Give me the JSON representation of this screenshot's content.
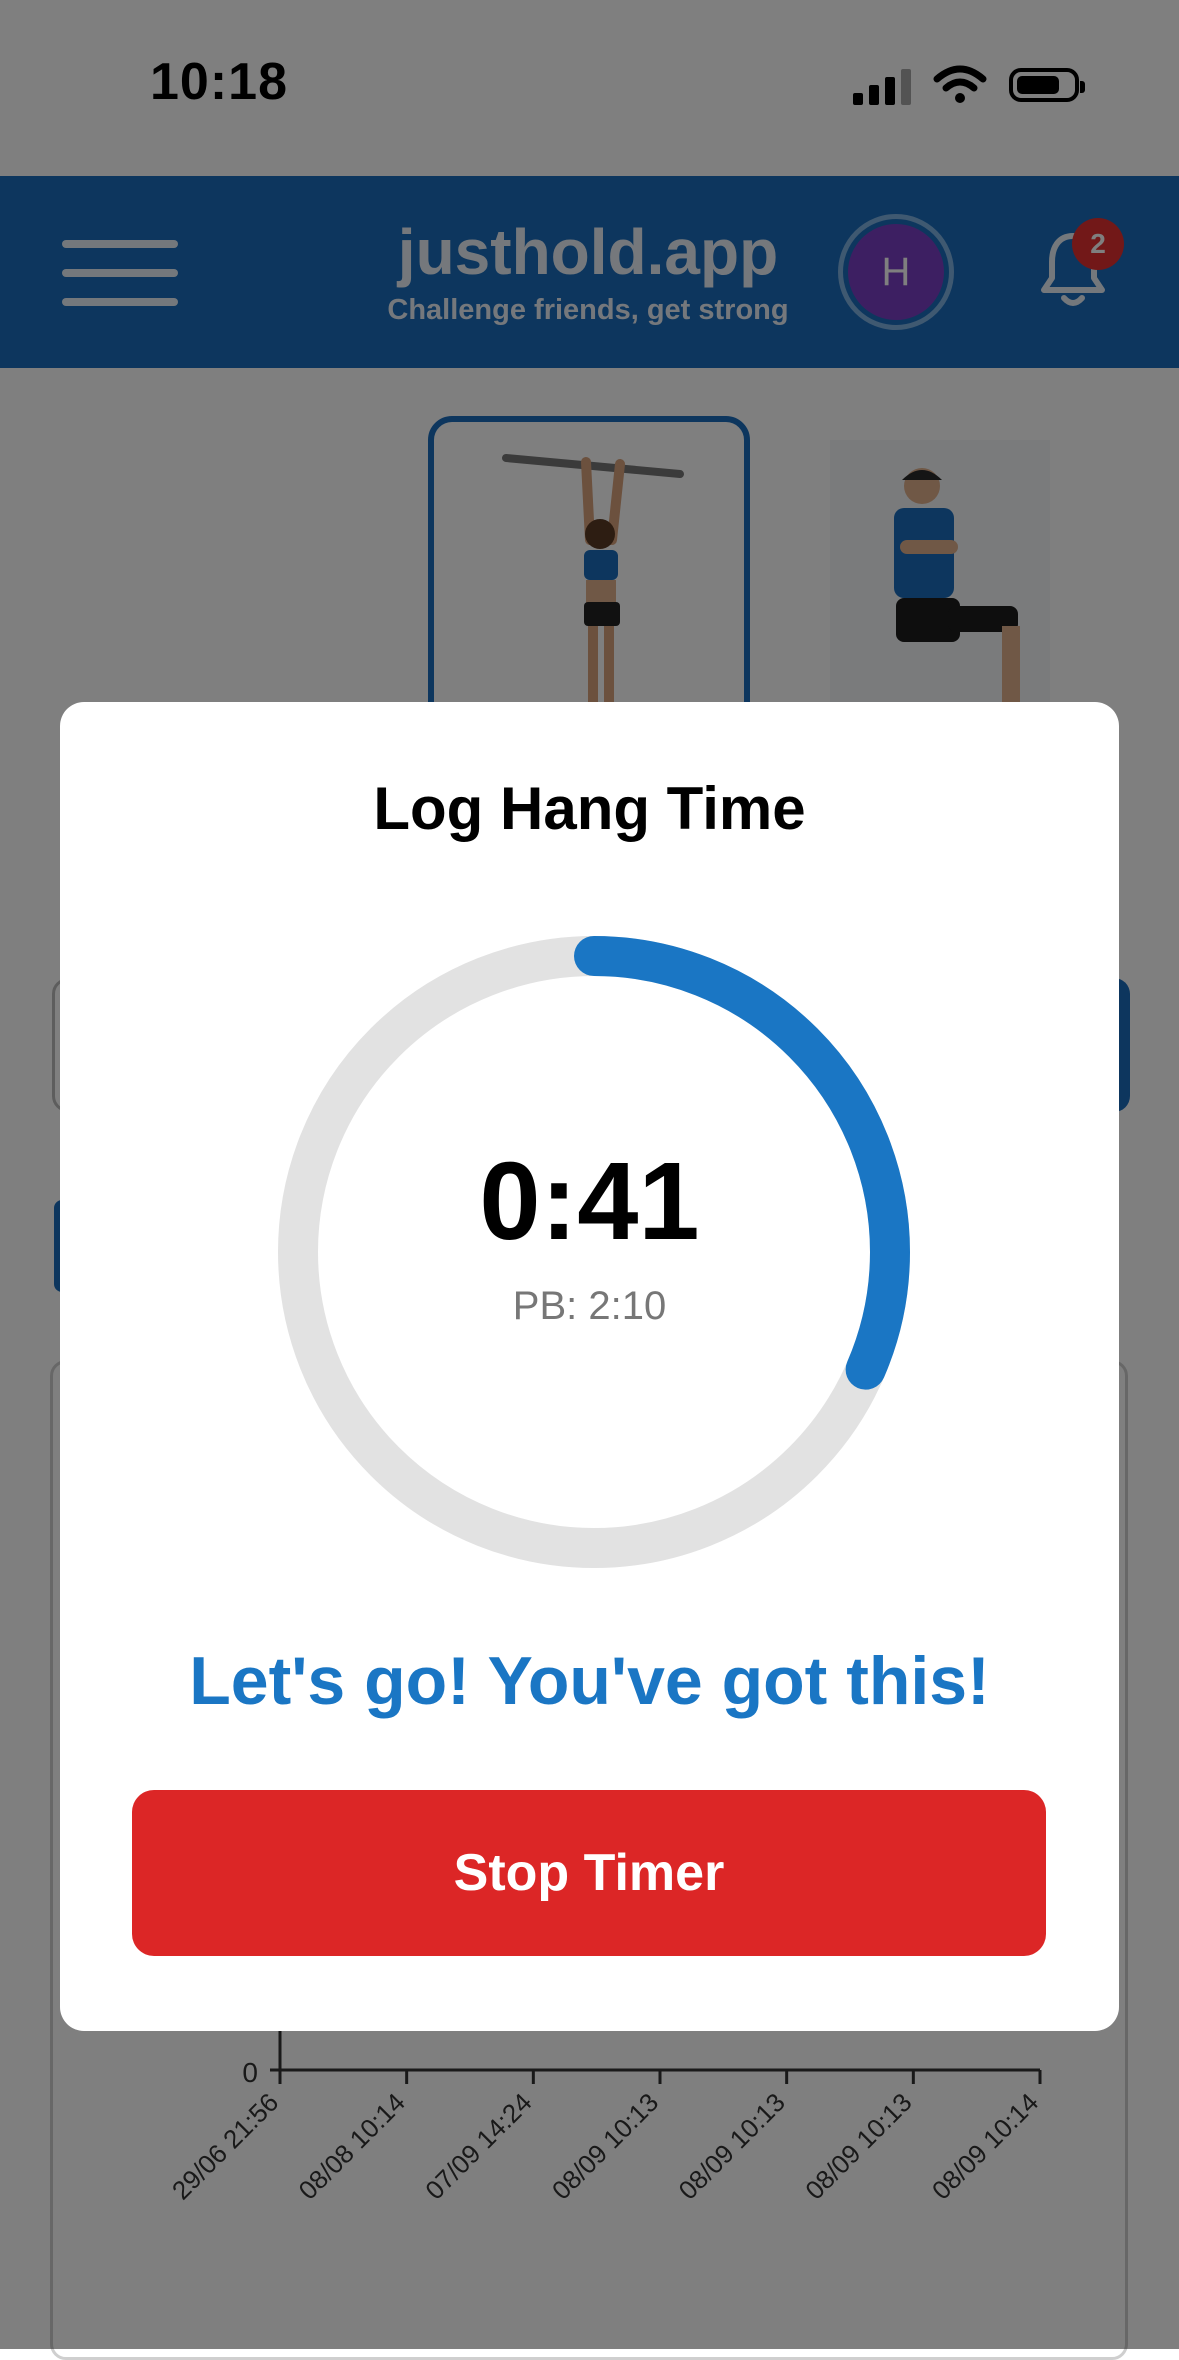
{
  "status_bar": {
    "time": "10:18"
  },
  "header": {
    "app_name": "justhold.app",
    "tagline": "Challenge friends, get strong",
    "avatar_initial": "H",
    "notification_count": "2"
  },
  "chart_data": {
    "type": "line",
    "x": [
      "29/06 21:56",
      "08/08 10:14",
      "07/09 14:24",
      "08/09 10:13",
      "08/09 10:13",
      "08/09 10:13",
      "08/09 10:14"
    ],
    "y_tick_labels": [
      "0"
    ],
    "title": "",
    "xlabel": "",
    "ylabel": ""
  },
  "modal": {
    "title": "Log Hang Time",
    "timer_value": "0:41",
    "personal_best": "PB: 2:10",
    "progress": 0.315,
    "motivation": "Let's go! You've got this!",
    "stop_button": "Stop Timer"
  },
  "colors": {
    "brand": "#1a6dbd",
    "progress": "#1a76c4",
    "track": "#e2e2e2",
    "danger": "#dc2626"
  }
}
